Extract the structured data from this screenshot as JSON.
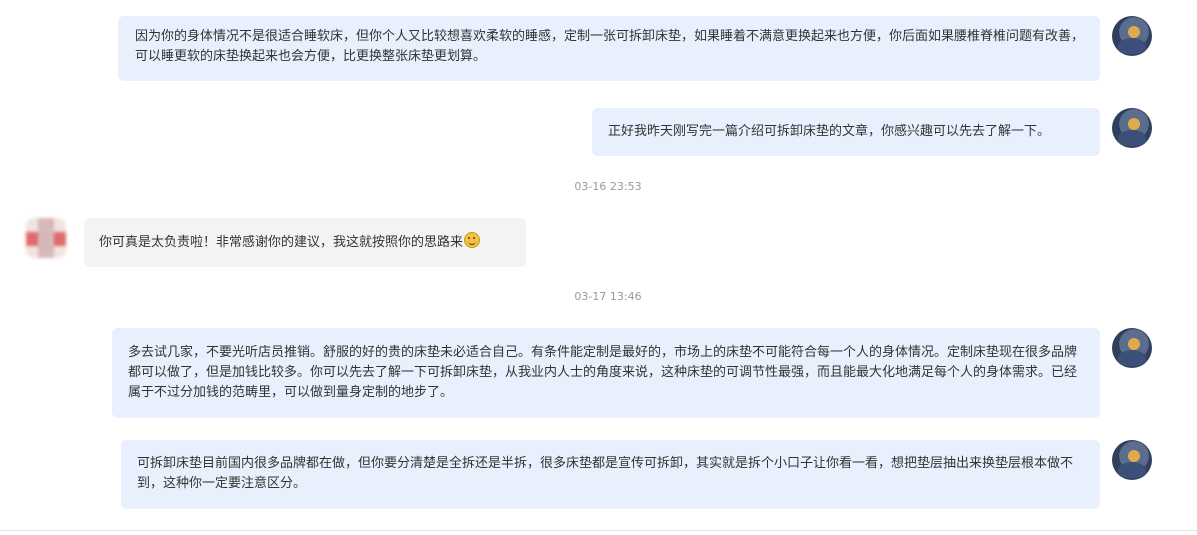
{
  "messages": [
    {
      "text": "因为你的身体情况不是很适合睡软床，但你个人又比较想喜欢柔软的睡感，定制一张可拆卸床垫，如果睡着不满意更换起来也方便，你后面如果腰椎脊椎问题有改善，可以睡更软的床垫换起来也会方便，比更换整张床垫更划算。"
    },
    {
      "text": "正好我昨天刚写完一篇介绍可拆卸床垫的文章，你感兴趣可以先去了解一下。"
    },
    {
      "text": "你可真是太负责啦！非常感谢你的建议，我这就按照你的思路来"
    },
    {
      "text": "多去试几家，不要光听店员推销。舒服的好的贵的床垫未必适合自己。有条件能定制是最好的，市场上的床垫不可能符合每一个人的身体情况。定制床垫现在很多品牌都可以做了，但是加钱比较多。你可以先去了解一下可拆卸床垫，从我业内人士的角度来说，这种床垫的可调节性最强，而且能最大化地满足每个人的身体需求。已经属于不过分加钱的范畴里，可以做到量身定制的地步了。"
    },
    {
      "text": "可拆卸床垫目前国内很多品牌都在做，但你要分清楚是全拆还是半拆，很多床垫都是宣传可拆卸，其实就是拆个小口子让你看一看，想把垫层抽出来换垫层根本做不到，这种你一定要注意区分。"
    }
  ],
  "timestamps": [
    "03-16 23:53",
    "03-17 13:46"
  ],
  "icons": {
    "self_avatar": "user-avatar-painting",
    "other_avatar": "blurred-user-avatar",
    "emoji": "smiling-face-emoji"
  },
  "colors": {
    "outgoing_bubble": "#e8f0fe",
    "incoming_bubble": "#f3f3f3",
    "timestamp_text": "#999999"
  }
}
